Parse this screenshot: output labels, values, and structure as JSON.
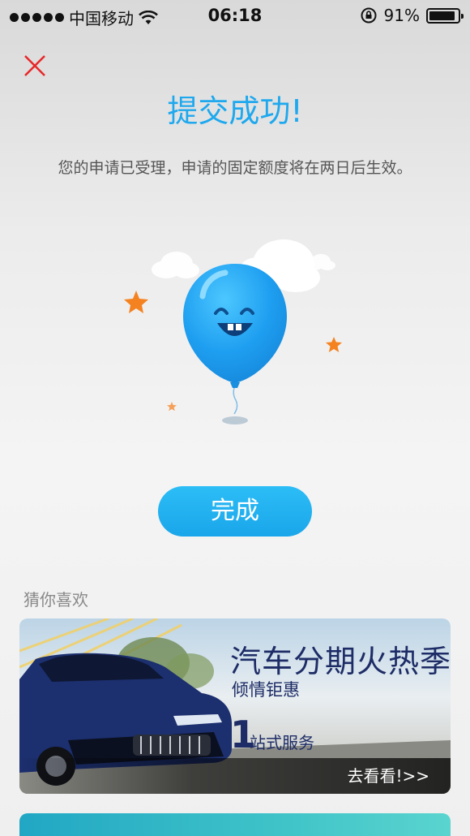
{
  "status_bar": {
    "carrier": "中国移动",
    "time": "06:18",
    "battery_percent": "91%",
    "battery_level": 0.91
  },
  "close_icon": "close-icon",
  "title": "提交成功!",
  "description": "您的申请已受理，申请的固定额度将在两日后生效。",
  "done_button": "完成",
  "recommend": {
    "label": "猜你喜欢",
    "banner": {
      "headline": "汽车分期火热季",
      "subline": "倾情钜惠",
      "big_number": "1",
      "service_text": "站式服务",
      "cta": "去看看!>>"
    }
  },
  "colors": {
    "accent": "#1ea8ee",
    "close": "#e8272a",
    "banner_text": "#1d2c66"
  }
}
